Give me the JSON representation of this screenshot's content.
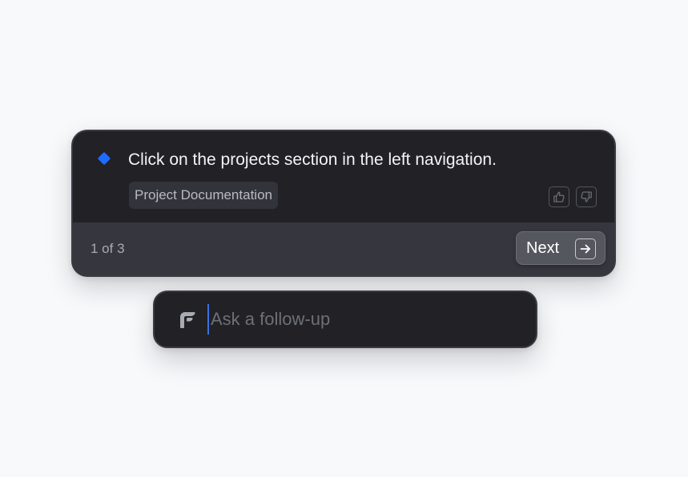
{
  "guide": {
    "instruction": "Click on the projects section in the left navigation.",
    "context_chip": "Project Documentation",
    "feedback": {
      "like_icon": "thumbs-up-icon",
      "dislike_icon": "thumbs-down-icon"
    },
    "marker_icon": "diamond-icon",
    "marker_color": "#1f6bff",
    "step_counter": "1 of 3",
    "next_label": "Next",
    "next_icon": "arrow-right-icon"
  },
  "followup": {
    "placeholder": "Ask a follow-up",
    "value": "",
    "logo_icon": "brand-logo-icon"
  }
}
